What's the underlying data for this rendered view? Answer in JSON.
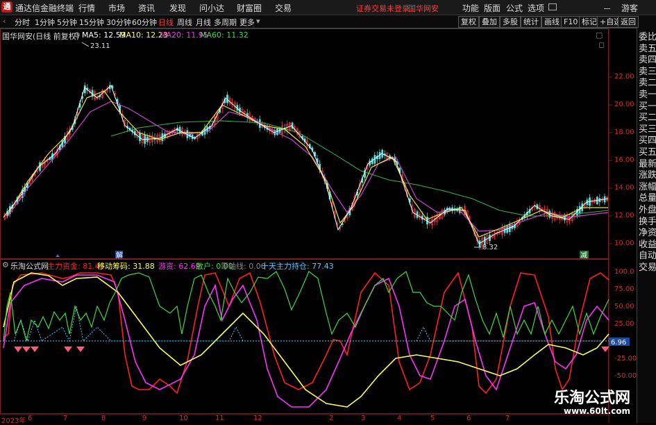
{
  "menubar": {
    "logo": "通",
    "app_title": "通达信金融终端",
    "menus": [
      "行情",
      "市场",
      "资讯",
      "发现",
      "问小达",
      "财富圈",
      "交易"
    ],
    "alert": "证券交易未登录",
    "alert_stock": "国华网安",
    "right_menus": [
      "功能",
      "版面",
      "公式",
      "选项"
    ],
    "guest": "游客"
  },
  "toolbar": {
    "periods": [
      "分时",
      "1分钟",
      "5分钟",
      "15分钟",
      "30分钟",
      "60分钟",
      "日线",
      "周线",
      "月线",
      "多周期",
      "更多"
    ],
    "active_period": "日线",
    "buttons": [
      "复权",
      "叠加",
      "多股",
      "统计",
      "画线",
      "F10",
      "标记",
      "+自选",
      "返回"
    ]
  },
  "main_chart": {
    "stock_title": "国华网安(日线 前复权)",
    "ma5": "MA5: 12.59",
    "ma10": "MA10: 12.23",
    "ma20": "MA20: 11.95",
    "ma60": "MA60: 11.32",
    "high_label": "23.11",
    "low_label": "8.32",
    "y_ticks": [
      "22.00",
      "20.00",
      "18.00",
      "16.00",
      "14.00",
      "12.00",
      "10.00"
    ],
    "jie_tag": "解",
    "jian_tag": "减"
  },
  "indicator": {
    "name": "乐淘公式网",
    "zhuli": "主力资金: 81.49",
    "yidong": "移动筹码: 31.88",
    "youzi": "游资: 62.69",
    "sanhu": "散户: 0.00",
    "zeroaxis": "零轴线: 0.00",
    "shitian": "十天主力持仓: 77.43",
    "y_ticks": [
      "100.0",
      "75.00",
      "50.00",
      "25.00",
      "-25.00",
      "-50.00"
    ],
    "current_value": "6.96"
  },
  "x_axis": [
    "2023年",
    "6",
    "7",
    "8",
    "9",
    "10",
    "11",
    "12",
    "2",
    "3",
    "4",
    "5",
    "6",
    "7"
  ],
  "side_panel": [
    "委比",
    "卖五",
    "卖四",
    "卖三",
    "卖二",
    "卖一",
    "买一",
    "买二",
    "买三",
    "买四",
    "买五",
    "最新",
    "涨跌",
    "涨幅",
    "总量",
    "外盘",
    "换手",
    "净资",
    "收益",
    "自动",
    "交易"
  ],
  "watermark": {
    "text": "乐淘公式网",
    "url": "www.60lt.com"
  },
  "colors": {
    "red": "#ff2020",
    "green": "#3cdc3c",
    "magenta": "#ff30ff",
    "yellow": "#ffff50",
    "white": "#ffffff",
    "cyan": "#50c8ff",
    "axis": "#c83232"
  }
}
